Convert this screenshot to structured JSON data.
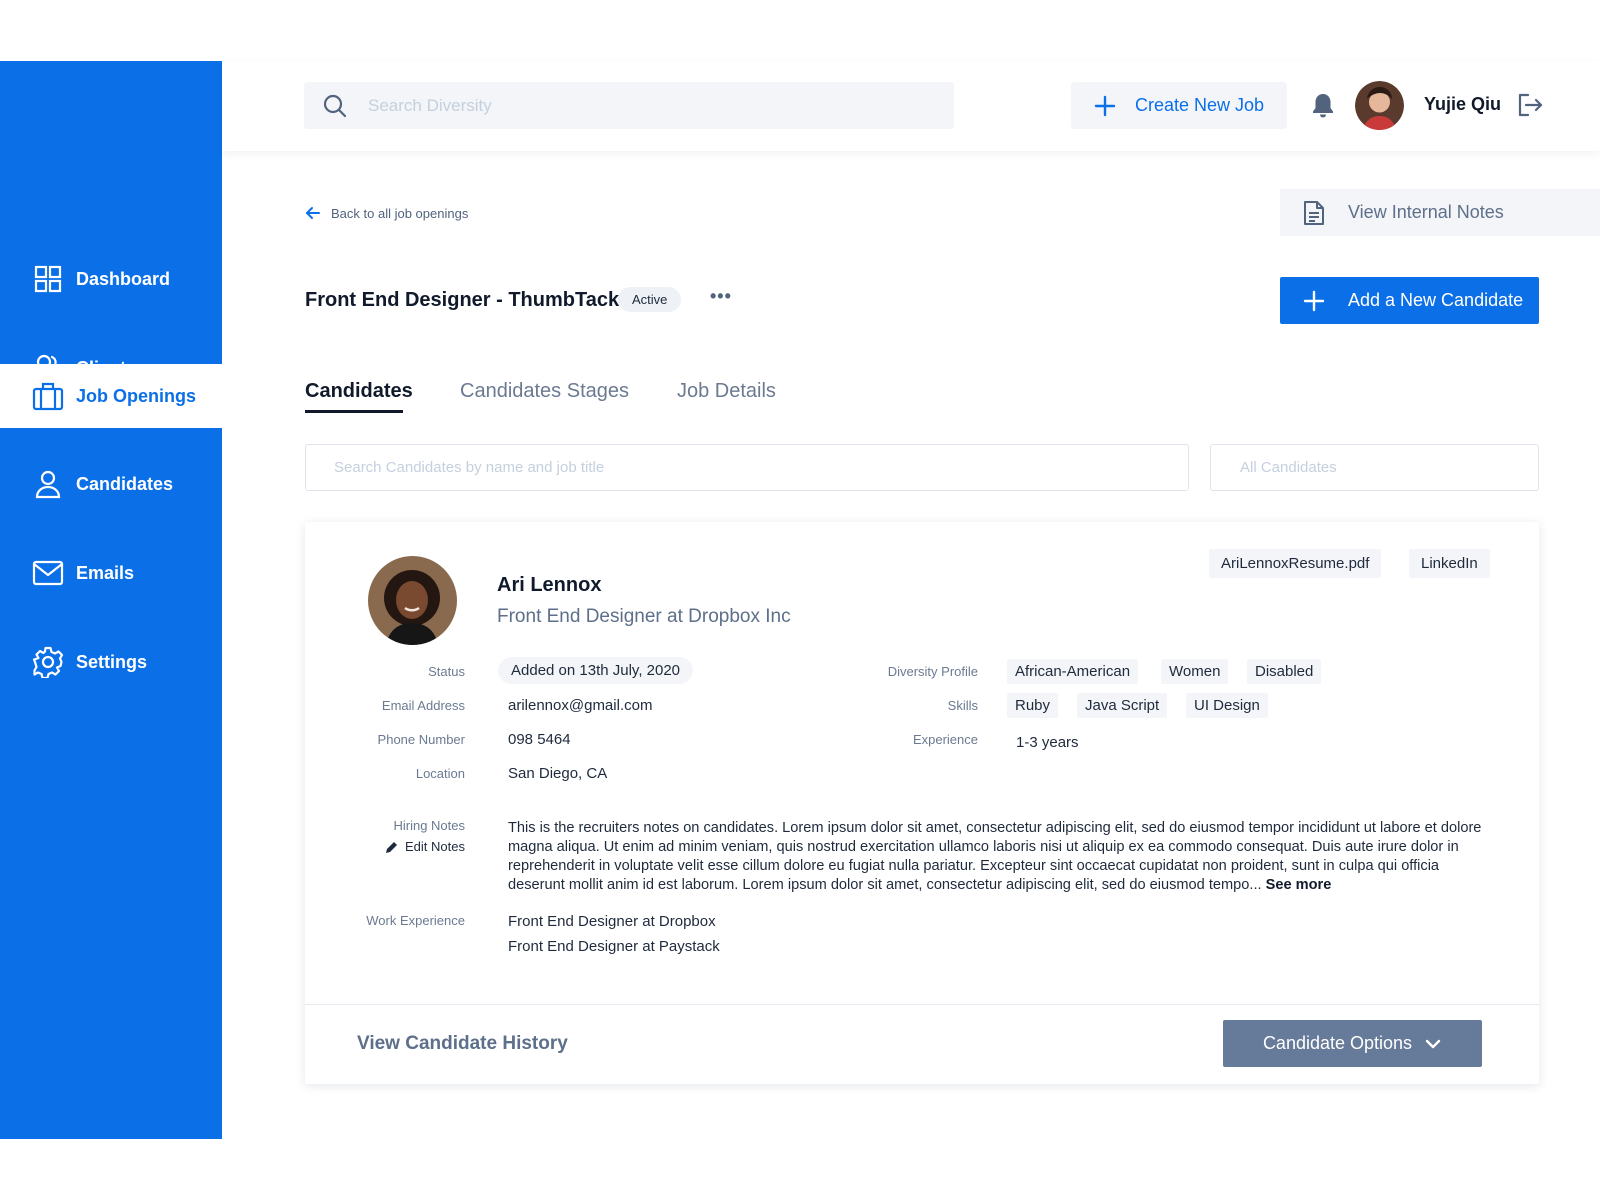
{
  "app": {
    "brand_color": "#0b6fe8",
    "sidebar_active_color": "#ffffff"
  },
  "sidebar": {
    "items": [
      {
        "label": "Dashboard",
        "icon": "grid-icon"
      },
      {
        "label": "Clients",
        "icon": "users-icon"
      },
      {
        "label": "Job Openings",
        "icon": "briefcase-icon",
        "active": true
      },
      {
        "label": "Candidates",
        "icon": "user-icon"
      },
      {
        "label": "Emails",
        "icon": "mail-icon"
      },
      {
        "label": "Settings",
        "icon": "gear-icon"
      }
    ]
  },
  "header": {
    "search_placeholder": "Search Diversity",
    "create_job_label": "Create New Job",
    "user_name": "Yujie Qiu"
  },
  "page": {
    "back_label": "Back to all job openings",
    "internal_notes_label": "View Internal Notes",
    "job_title": "Front End Designer - ThumbTack",
    "job_status": "Active",
    "more_label": "•••",
    "add_candidate_label": "Add a New Candidate",
    "tabs": [
      {
        "label": "Candidates",
        "active": true
      },
      {
        "label": "Candidates Stages",
        "active": false
      },
      {
        "label": "Job Details",
        "active": false
      }
    ],
    "candidate_search_placeholder": "Search Candidates by name and job title",
    "filter_label": "All Candidates"
  },
  "candidate": {
    "name": "Ari Lennox",
    "role": "Front End Designer at Dropbox Inc",
    "resume_file": "AriLennoxResume.pdf",
    "linkedin_label": "LinkedIn",
    "labels": {
      "status": "Status",
      "email": "Email Address",
      "phone": "Phone Number",
      "location": "Location",
      "hiring_notes": "Hiring Notes",
      "edit_notes": "Edit Notes",
      "work_experience": "Work Experience",
      "diversity": "Diversity Profile",
      "skills": "Skills",
      "experience": "Experience"
    },
    "status": "Added on 13th July, 2020",
    "email": "arilennox@gmail.com",
    "phone": "098 5464",
    "location": "San Diego, CA",
    "diversity_profile": [
      "African-American",
      "Women",
      "Disabled"
    ],
    "skills": [
      "Ruby",
      "Java Script",
      "UI Design"
    ],
    "experience": "1-3 years",
    "hiring_notes": "This is the recruiters notes on candidates. Lorem ipsum dolor sit amet, consectetur adipiscing elit, sed do eiusmod tempor incididunt ut labore et dolore magna aliqua. Ut enim ad minim veniam, quis nostrud exercitation ullamco laboris nisi ut aliquip ex ea commodo consequat. Duis aute irure dolor in reprehenderit in voluptate velit esse cillum dolore eu fugiat nulla pariatur. Excepteur sint occaecat cupidatat non proident, sunt in culpa qui officia deserunt mollit anim id est laborum. Lorem ipsum dolor sit amet, consectetur adipiscing elit, sed do eiusmod tempo...",
    "see_more_label": "See more",
    "work_experience": [
      "Front End Designer at Dropbox",
      "Front End Designer at Paystack"
    ],
    "history_label": "View Candidate History",
    "options_label": "Candidate Options"
  }
}
